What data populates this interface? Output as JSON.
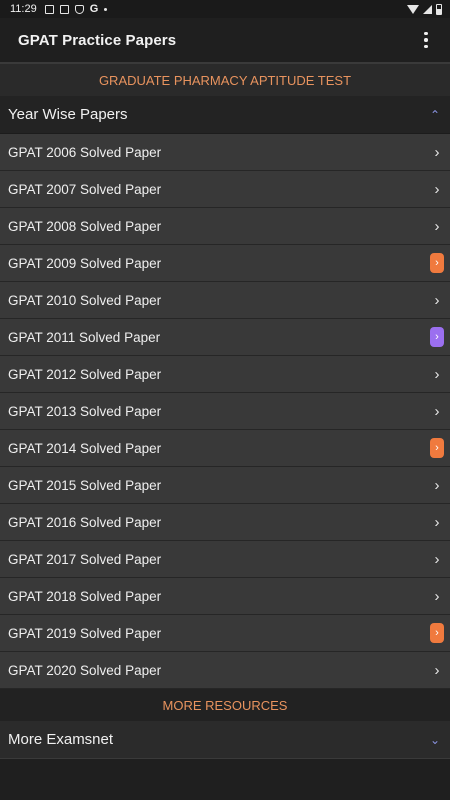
{
  "status_bar": {
    "time": "11:29"
  },
  "app_bar": {
    "title": "GPAT Practice Papers"
  },
  "banner": {
    "text": "GRADUATE PHARMACY APTITUDE TEST"
  },
  "year_group": {
    "title": "Year Wise Papers",
    "papers": [
      {
        "label": "GPAT 2006 Solved Paper",
        "badge": null
      },
      {
        "label": "GPAT 2007 Solved Paper",
        "badge": null
      },
      {
        "label": "GPAT 2008 Solved Paper",
        "badge": null
      },
      {
        "label": "GPAT 2009 Solved Paper",
        "badge": "#f07a3e"
      },
      {
        "label": "GPAT 2010 Solved Paper",
        "badge": null
      },
      {
        "label": "GPAT 2011 Solved Paper",
        "badge": "#9b6ff0"
      },
      {
        "label": "GPAT 2012 Solved Paper",
        "badge": null
      },
      {
        "label": "GPAT 2013 Solved Paper",
        "badge": null
      },
      {
        "label": "GPAT 2014 Solved Paper",
        "badge": "#f07a3e"
      },
      {
        "label": "GPAT 2015 Solved Paper",
        "badge": null
      },
      {
        "label": "GPAT 2016 Solved Paper",
        "badge": null
      },
      {
        "label": "GPAT 2017 Solved Paper",
        "badge": null
      },
      {
        "label": "GPAT 2018 Solved Paper",
        "badge": null
      },
      {
        "label": "GPAT 2019 Solved Paper",
        "badge": "#f07a3e"
      },
      {
        "label": "GPAT 2020 Solved Paper",
        "badge": null
      }
    ]
  },
  "resources": {
    "banner": "MORE RESOURCES",
    "more_title": "More Examsnet"
  },
  "icons": {
    "arrow": "›",
    "chevron_up": "⌃",
    "chevron_down": "⌄"
  },
  "colors": {
    "accent_orange": "#e8935e",
    "chevron_blue": "#8a93e0"
  }
}
